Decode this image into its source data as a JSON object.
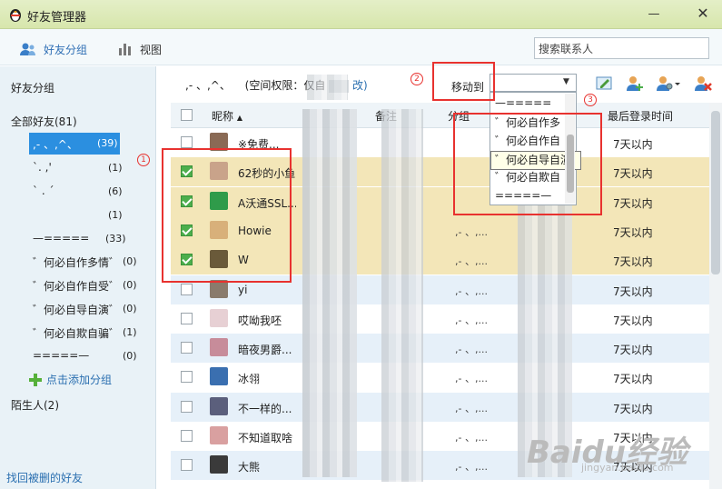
{
  "window": {
    "title": "好友管理器",
    "minimize_label": "—",
    "close_label": "✕"
  },
  "toolbar": {
    "tab_groups": "好友分组",
    "tab_view": "视图",
    "search_placeholder": "搜索联系人"
  },
  "sidebar": {
    "header": "好友分组",
    "all_friends": "全部好友(81)",
    "groups": [
      {
        "label": ",- 、,^、",
        "count": "(39)",
        "selected": true
      },
      {
        "label": "`.        ,'",
        "count": "(1)"
      },
      {
        "label": "` . ´",
        "count": "(6)"
      },
      {
        "label": "",
        "count": "(1)"
      },
      {
        "label": "—=====",
        "count": "(33)"
      },
      {
        "label": "゛何必自作多情゛",
        "count": "(0)"
      },
      {
        "label": "゛何必自作自受゛",
        "count": "(0)"
      },
      {
        "label": "゛何必自导自演゛",
        "count": "(0)"
      },
      {
        "label": "゛何必自欺自骗゛",
        "count": "(1)"
      },
      {
        "label": "=====—",
        "count": "(0)"
      }
    ],
    "add_group": "点击添加分组",
    "strangers": "陌生人(2)",
    "recover": "找回被删的好友"
  },
  "info_bar": {
    "group_name": ",- 、,^、",
    "permission": "(空间权限：仅自",
    "permission_end": "改)",
    "move_to": "移动到"
  },
  "table": {
    "headers": {
      "nickname": "昵称",
      "remark": "备注",
      "group": "分组",
      "last_login": "最后登录时间"
    },
    "rows": [
      {
        "nick": "※免费...",
        "group": "",
        "last": "7天以内",
        "checked": false,
        "highlight": false,
        "avatar": "#8a6a55"
      },
      {
        "nick": "62秒的小鱼",
        "group": "",
        "last": "7天以内",
        "checked": true,
        "highlight": true,
        "avatar": "#c9a38a"
      },
      {
        "nick": "A沃通SSL...",
        "group": "",
        "last": "7天以内",
        "checked": true,
        "highlight": true,
        "avatar": "#2f9b4a"
      },
      {
        "nick": "Howie",
        "group": ",- 、,...",
        "last": "7天以内",
        "checked": true,
        "highlight": true,
        "avatar": "#d8b07a"
      },
      {
        "nick": "W",
        "group": ",- 、,...",
        "last": "7天以内",
        "checked": true,
        "highlight": true,
        "avatar": "#6a5a3a"
      },
      {
        "nick": "yi",
        "group": ",- 、,...",
        "last": "7天以内",
        "checked": false,
        "highlight": false,
        "avatar": "#8a7b6c"
      },
      {
        "nick": "哎呦我呸",
        "group": ",- 、,...",
        "last": "7天以内",
        "checked": false,
        "highlight": false,
        "avatar": "#e7d0d4"
      },
      {
        "nick": "暗夜男爵...",
        "group": ",- 、,...",
        "last": "7天以内",
        "checked": false,
        "highlight": false,
        "avatar": "#c78c9a"
      },
      {
        "nick": "冰翎",
        "group": ",- 、,...",
        "last": "7天以内",
        "checked": false,
        "highlight": false,
        "avatar": "#3a6fb0"
      },
      {
        "nick": "不一样的...",
        "group": ",- 、,...",
        "last": "7天以内",
        "checked": false,
        "highlight": false,
        "avatar": "#5b5f7c"
      },
      {
        "nick": "不知道取啥",
        "group": ",- 、,...",
        "last": "7天以内",
        "checked": false,
        "highlight": false,
        "avatar": "#d9a0a0"
      },
      {
        "nick": "大熊",
        "group": ",- 、,...",
        "last": "7天以内",
        "checked": false,
        "highlight": false,
        "avatar": "#3a3a3a"
      }
    ]
  },
  "dropdown": {
    "items": [
      "—=====",
      "゛何必自作多",
      "゛何必自作自",
      "゛何必自导自演゛",
      "゛何必自欺自",
      "=====—"
    ],
    "highlighted_index": 3
  },
  "annotations": {
    "n1": "1",
    "n2": "2",
    "n3": "3"
  },
  "watermark": {
    "brand": "Baidu经验",
    "url": "jingyan.baidu.com"
  },
  "colors": {
    "accent": "#2b8fe0",
    "highlight_row": "#f3e6b8",
    "alt_row": "#e6f0f9",
    "check": "#4cae4c",
    "red": "#e8322f"
  }
}
